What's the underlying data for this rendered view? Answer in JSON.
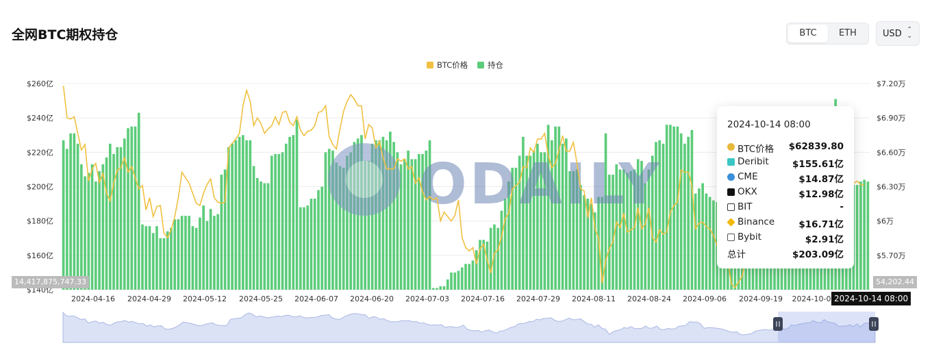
{
  "title": "全网BTC期权持仓",
  "toggle": {
    "btc": "BTC",
    "eth": "ETH"
  },
  "currency": {
    "label": "USD"
  },
  "chart_data": {
    "type": "bar",
    "legend": [
      {
        "name": "BTC价格",
        "color": "#f0c040"
      },
      {
        "name": "持仓",
        "color": "#5ccc7a"
      }
    ],
    "y_left_ticks": [
      "$260亿",
      "$240亿",
      "$220亿",
      "$200亿",
      "$180亿",
      "$160亿",
      "$140亿"
    ],
    "y_left_range": [
      140,
      260
    ],
    "y_right_ticks": [
      "$7.20万",
      "$6.90万",
      "$6.60万",
      "$6.30万",
      "$6万",
      "$5.70万"
    ],
    "y_right_range": [
      53400,
      72000
    ],
    "x_ticks": [
      "2024-04-16",
      "2024-04-29",
      "2024-05-12",
      "2024-05-25",
      "2024-06-07",
      "2024-06-20",
      "2024-07-03",
      "2024-07-16",
      "2024-07-29",
      "2024-08-11",
      "2024-08-24",
      "2024-09-06",
      "2024-09-19",
      "2024-10-0"
    ],
    "series": [
      {
        "name": "持仓",
        "unit": "亿美元",
        "values": [
          227,
          222,
          231,
          231,
          225,
          213,
          206,
          208,
          213,
          203,
          209,
          213,
          217,
          225,
          219,
          223,
          223,
          228,
          234,
          235,
          235,
          243,
          178,
          177,
          177,
          173,
          177,
          170,
          170,
          174,
          176,
          181,
          181,
          183,
          183,
          183,
          177,
          176,
          182,
          189,
          180,
          187,
          183,
          184,
          207,
          210,
          223,
          225,
          227,
          229,
          230,
          227,
          227,
          212,
          205,
          203,
          202,
          202,
          218,
          219,
          219,
          220,
          225,
          229,
          230,
          239,
          188,
          188,
          189,
          193,
          193,
          198,
          200,
          220,
          222,
          221,
          214,
          212,
          211,
          218,
          220,
          226,
          228,
          230,
          215,
          215,
          225,
          227,
          227,
          229,
          227,
          232,
          226,
          220,
          213,
          216,
          221,
          216,
          216,
          219,
          219,
          221,
          227,
          141,
          141,
          142,
          142,
          146,
          150,
          150,
          151,
          153,
          155,
          155,
          157,
          163,
          169,
          169,
          168,
          176,
          178,
          176,
          186,
          193,
          203,
          211,
          211,
          218,
          229,
          218,
          218,
          221,
          225,
          220,
          220,
          236,
          227,
          235,
          235,
          225,
          228,
          209,
          209,
          210,
          201,
          195,
          193,
          190,
          185,
          194,
          194,
          231,
          207,
          207,
          213,
          210,
          210,
          208,
          209,
          210,
          216,
          215,
          202,
          210,
          218,
          226,
          227,
          225,
          236,
          236,
          235,
          235,
          231,
          225,
          229,
          233,
          196,
          199,
          202,
          196,
          194,
          192,
          191,
          196,
          194,
          197,
          186,
          187,
          178,
          166,
          170,
          185,
          181,
          175,
          183,
          186,
          186,
          169,
          186,
          200,
          196,
          175,
          201,
          201,
          204,
          200,
          212,
          209,
          205,
          203,
          203,
          204,
          221,
          207,
          225,
          251,
          197,
          197,
          197,
          199,
          201,
          201,
          203,
          204,
          203
        ]
      },
      {
        "name": "BTC价格",
        "unit": "美元",
        "values": [
          71800,
          68900,
          68800,
          69000,
          67500,
          66000,
          66500,
          63200,
          64300,
          64800,
          63100,
          63900,
          62100,
          61400,
          63000,
          64200,
          64400,
          65300,
          64000,
          64500,
          63500,
          62500,
          62800,
          60600,
          61700,
          60000,
          60900,
          61000,
          58500,
          58100,
          58800,
          60000,
          61700,
          64000,
          63500,
          63000,
          62100,
          61200,
          61000,
          62100,
          62900,
          63400,
          61700,
          61300,
          61200,
          61300,
          66200,
          66600,
          67000,
          67500,
          70000,
          71400,
          70400,
          68200,
          68900,
          68400,
          67500,
          67900,
          68200,
          69000,
          68300,
          69400,
          69500,
          68500,
          68200,
          69000,
          67800,
          67300,
          67700,
          67800,
          68200,
          69400,
          69500,
          70000,
          67200,
          66500,
          66100,
          67900,
          69500,
          70400,
          71000,
          70600,
          70000,
          70000,
          67000,
          68300,
          68000,
          66200,
          66800,
          65300,
          64300,
          64300,
          64300,
          65200,
          65000,
          65200,
          64300,
          64500,
          63000,
          63500,
          62200,
          61500,
          61800,
          61500,
          61700,
          59600,
          60400,
          60000,
          59600,
          60100,
          61500,
          58100,
          57200,
          56900,
          57200,
          55700,
          57100,
          57500,
          56100,
          54900,
          56700,
          57000,
          58200,
          59800,
          60300,
          62500,
          62800,
          63100,
          64500,
          64400,
          66200,
          65800,
          67000,
          67000,
          67500,
          65500,
          64400,
          64800,
          66000,
          67300,
          65900,
          65900,
          66700,
          64800,
          62500,
          62300,
          59900,
          61700,
          58900,
          58100,
          54000,
          56000,
          57100,
          57700,
          59500,
          59000,
          60300,
          58600,
          58800,
          59000,
          60800,
          58900,
          59300,
          60800,
          58100,
          57700,
          58800,
          58400,
          58600,
          60400,
          61000,
          61300,
          64200,
          64000,
          64000,
          62800,
          58900,
          59400,
          59500,
          59100,
          58900,
          58300,
          57400,
          56200,
          55800,
          56100,
          53900,
          53600,
          54100,
          54600,
          56400,
          57200,
          57600,
          58000,
          57400,
          57900,
          60000,
          60300,
          58100,
          58800,
          61800,
          61100,
          62300,
          62600,
          63400,
          63500,
          65100,
          63800,
          63300,
          65900,
          64100,
          63500,
          63000,
          60500,
          60800,
          60700,
          61800,
          60400,
          62500,
          60000,
          63000,
          63200,
          62900,
          62800
        ]
      }
    ],
    "tooltip": {
      "time": "2024-10-14 08:00",
      "rows": [
        {
          "name": "BTC价格",
          "value": "$62839.80",
          "icon": "btc-coin-icon",
          "color": "#e7b93a"
        },
        {
          "name": "Deribit",
          "value": "$155.61亿",
          "icon": "deribit-icon",
          "color": "#3bc6c3"
        },
        {
          "name": "CME",
          "value": "$14.87亿",
          "icon": "cme-globe-icon",
          "color": "#3a8fd8"
        },
        {
          "name": "OKX",
          "value": "$12.98亿",
          "icon": "okx-icon",
          "color": "#111111"
        },
        {
          "name": "BIT",
          "value": "-",
          "icon": "bit-icon",
          "color": "#333333"
        },
        {
          "name": "Binance",
          "value": "$16.71亿",
          "icon": "binance-icon",
          "color": "#f0b90b"
        },
        {
          "name": "Bybit",
          "value": "$2.91亿",
          "icon": "bybit-icon",
          "color": "#555555"
        },
        {
          "name": "总计",
          "value": "$203.09亿",
          "icon": "",
          "color": "#222222"
        }
      ]
    },
    "axis_pointer": {
      "left_value": "14,417,875,747.33",
      "right_value": "54,202.44",
      "time": "2024-10-14 08:00"
    },
    "watermark": "ODAILY"
  }
}
